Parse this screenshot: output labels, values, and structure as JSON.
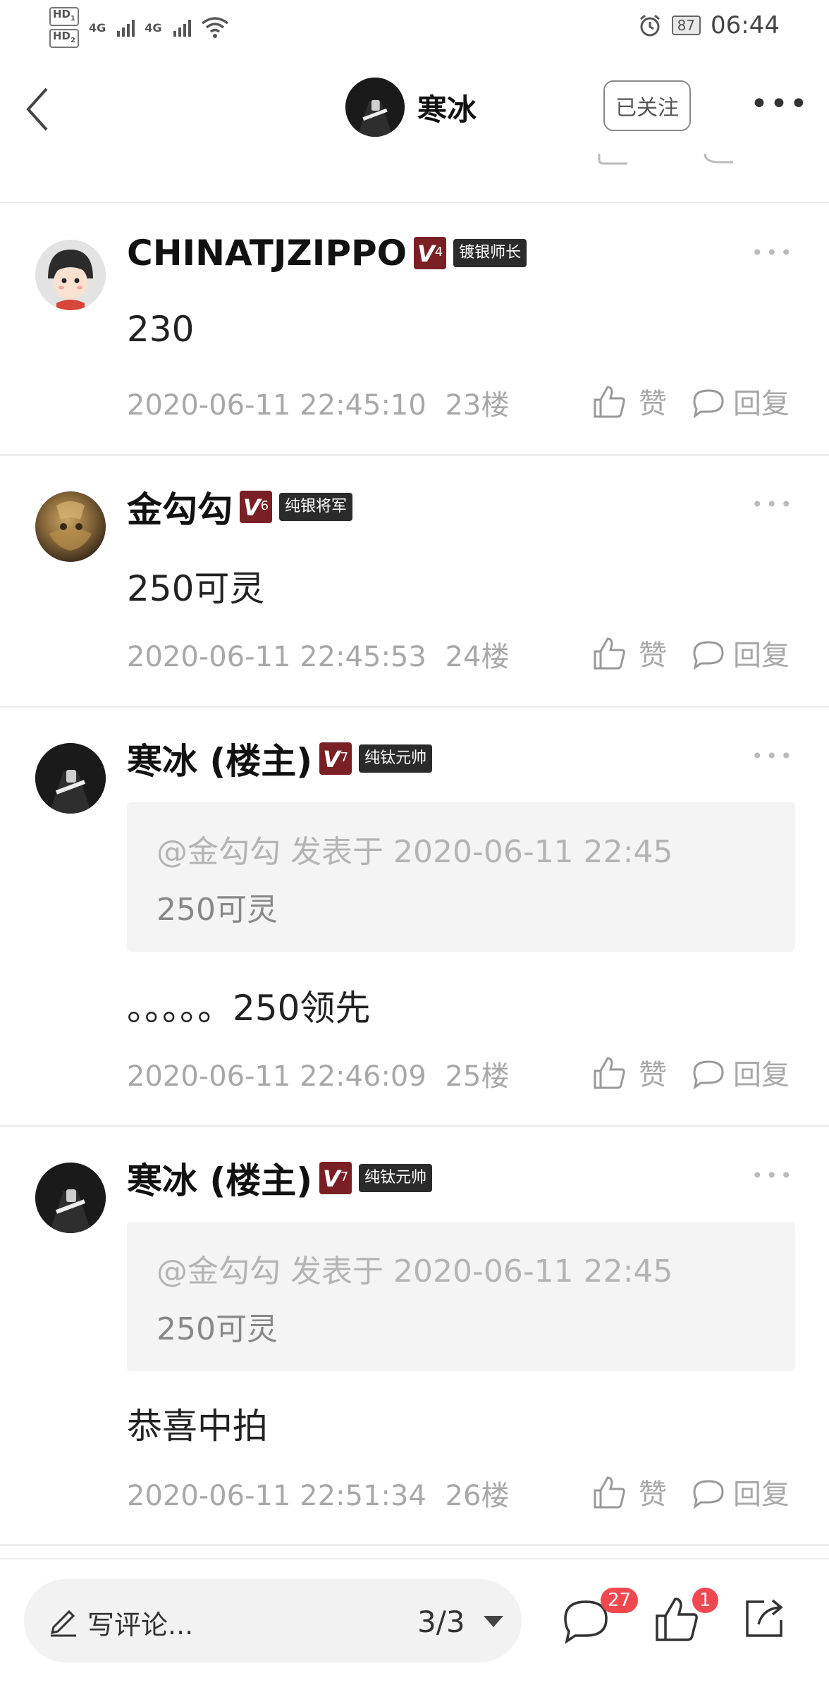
{
  "status_bar": {
    "hd1": "HD",
    "hd1_sub": "1",
    "hd2": "HD",
    "hd2_sub": "2",
    "net1": "4G",
    "net2": "4G",
    "battery": "87",
    "time": "06:44"
  },
  "nav": {
    "title": "寒冰",
    "follow_label": "已关注"
  },
  "posts": [
    {
      "user": "CHINATJZIPPO",
      "level": "4",
      "rank": "镀银师长",
      "content": "230",
      "timestamp": "2020-06-11 22:45:10",
      "floor": "23楼",
      "like_label": "赞",
      "reply_label": "回复"
    },
    {
      "user": "金勾勾",
      "level": "6",
      "rank": "纯银将军",
      "content": "250可灵",
      "timestamp": "2020-06-11 22:45:53",
      "floor": "24楼",
      "like_label": "赞",
      "reply_label": "回复"
    },
    {
      "user": "寒冰 (楼主)",
      "level": "7",
      "rank": "纯钛元帅",
      "quote_header": "@金勾勾 发表于 2020-06-11 22:45",
      "quote_body": "250可灵",
      "content": "。。。。。250领先",
      "timestamp": "2020-06-11 22:46:09",
      "floor": "25楼",
      "like_label": "赞",
      "reply_label": "回复"
    },
    {
      "user": "寒冰 (楼主)",
      "level": "7",
      "rank": "纯钛元帅",
      "quote_header": "@金勾勾 发表于 2020-06-11 22:45",
      "quote_body": "250可灵",
      "content": "恭喜中拍",
      "timestamp": "2020-06-11 22:51:34",
      "floor": "26楼",
      "like_label": "赞",
      "reply_label": "回复"
    }
  ],
  "bottom_bar": {
    "compose_placeholder": "写评论...",
    "page_indicator": "3/3",
    "comment_count": "27",
    "like_count": "1"
  },
  "colors": {
    "level_badge": "#7a1f24",
    "rank_badge": "#2b2b2b",
    "notify_badge": "#f0484f",
    "meta_text": "#a8a8a8"
  },
  "icons": [
    "back-arrow-icon",
    "more-icon",
    "like-icon",
    "reply-icon",
    "pen-icon",
    "dropdown-caret-icon",
    "comment-icon",
    "thumbs-up-icon",
    "share-icon",
    "alarm-icon",
    "wifi-icon",
    "signal-icon"
  ]
}
